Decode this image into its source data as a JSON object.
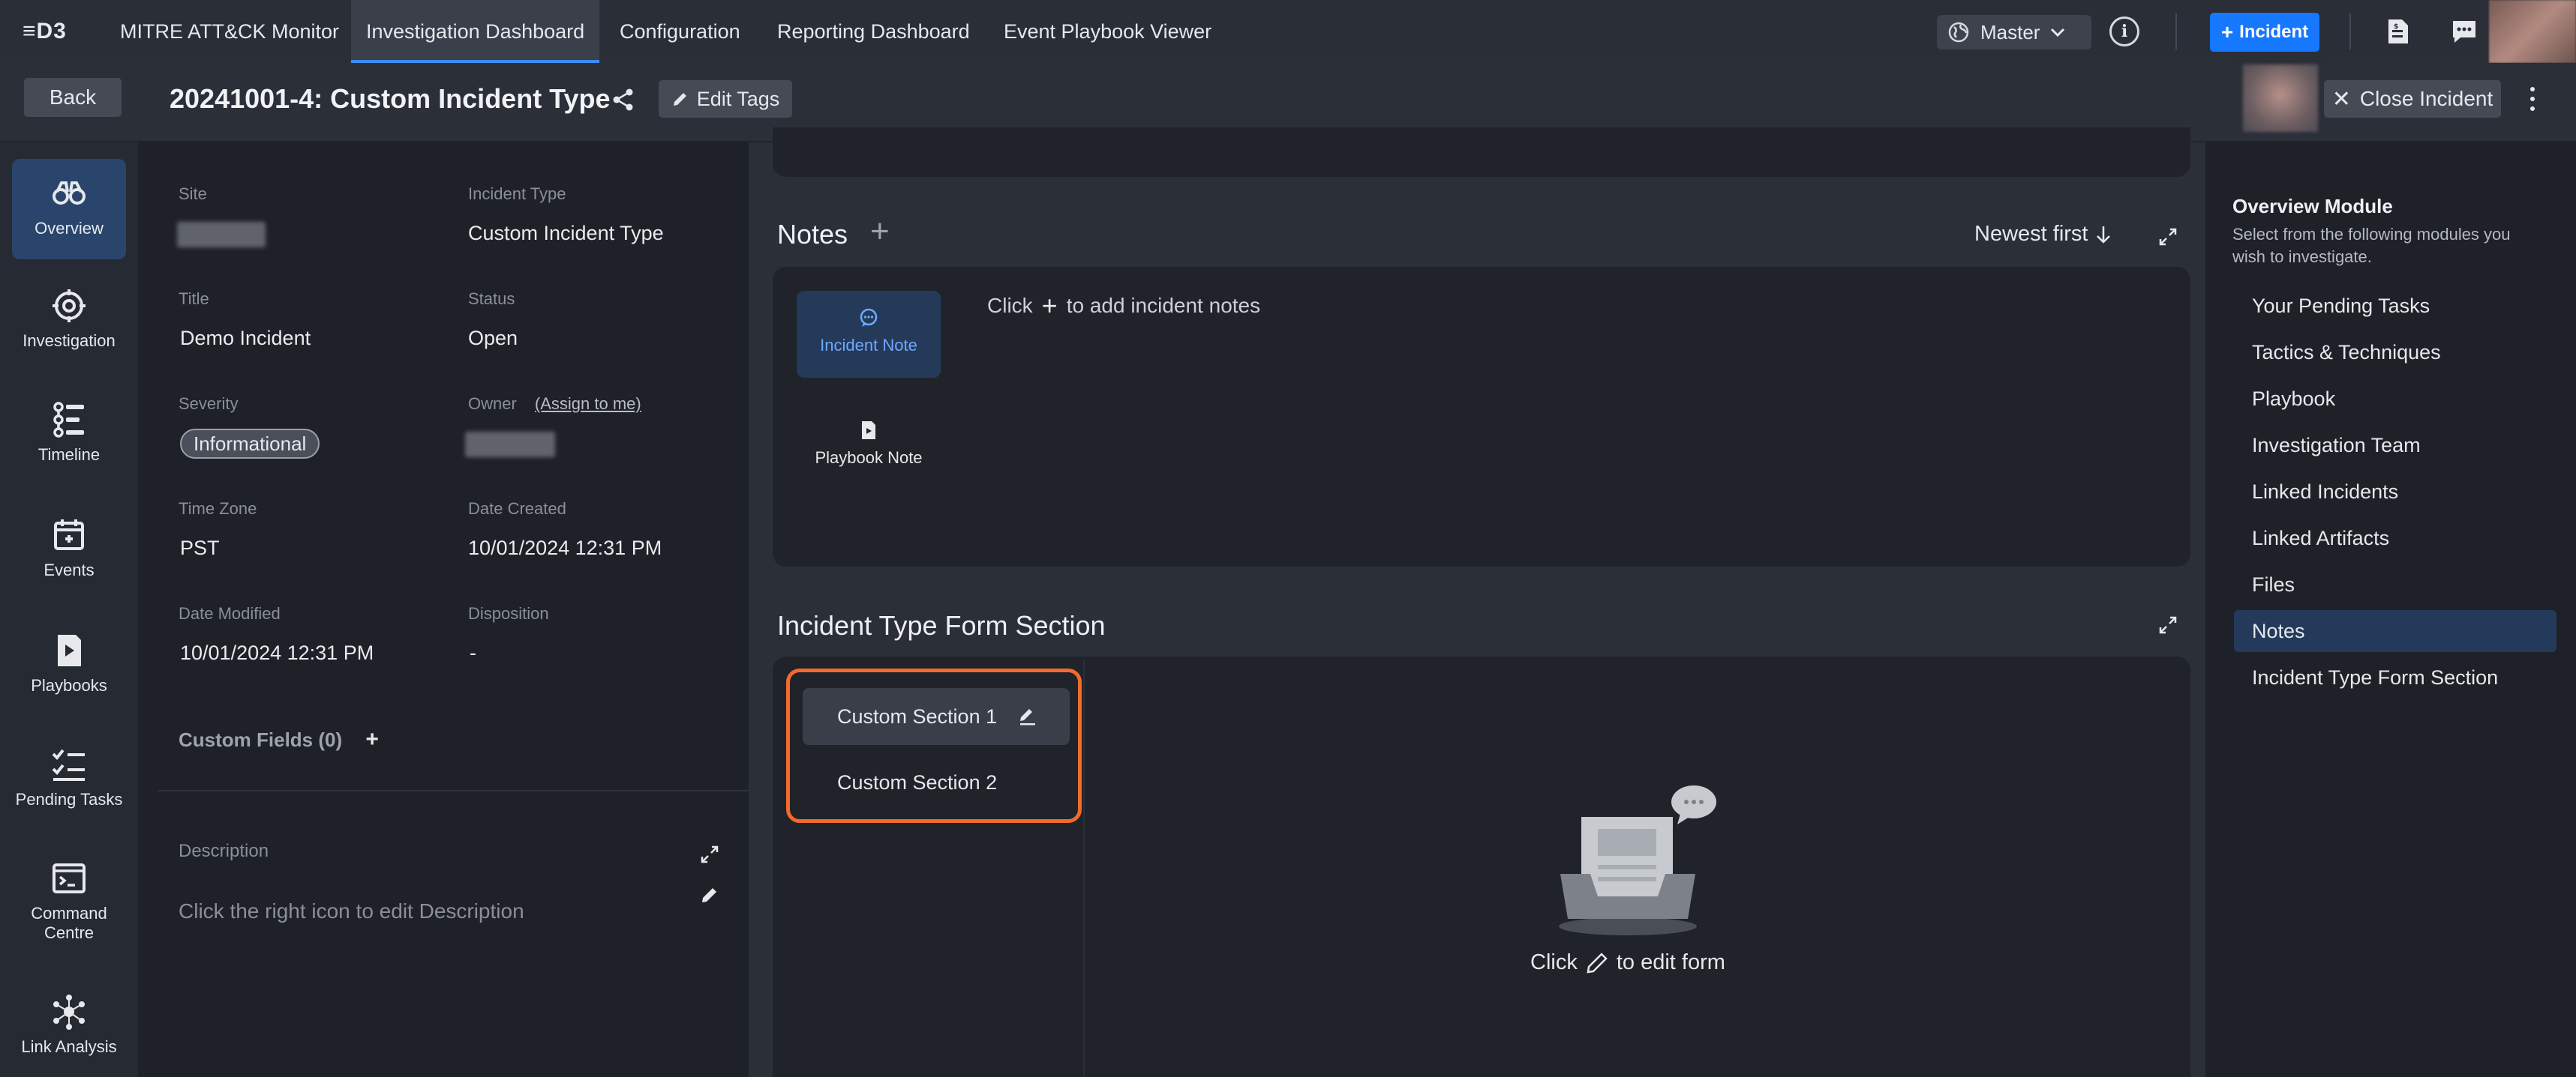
{
  "app": {
    "logo": "≡D3"
  },
  "nav": {
    "items": [
      "MITRE ATT&CK Monitor",
      "Investigation Dashboard",
      "Configuration",
      "Reporting Dashboard",
      "Event Playbook Viewer"
    ],
    "active_index": 1,
    "workspace": "Master",
    "new_incident_label": "Incident"
  },
  "header": {
    "back_label": "Back",
    "title": "20241001-4: Custom Incident Type",
    "edit_tags_label": "Edit Tags",
    "close_incident_label": "Close Incident"
  },
  "rail": {
    "items": [
      {
        "label": "Overview",
        "icon": "binoculars-icon"
      },
      {
        "label": "Investigation",
        "icon": "crosshair-icon"
      },
      {
        "label": "Timeline",
        "icon": "timeline-icon"
      },
      {
        "label": "Events",
        "icon": "calendar-icon"
      },
      {
        "label": "Playbooks",
        "icon": "playbook-icon"
      },
      {
        "label": "Pending Tasks",
        "icon": "checklist-icon"
      },
      {
        "label": "Command Centre",
        "icon": "terminal-icon"
      },
      {
        "label": "Link Analysis",
        "icon": "network-icon"
      }
    ],
    "active_index": 0
  },
  "info": {
    "site_label": "Site",
    "incident_type_label": "Incident Type",
    "incident_type": "Custom Incident Type",
    "title_label": "Title",
    "title": "Demo Incident",
    "status_label": "Status",
    "status": "Open",
    "severity_label": "Severity",
    "severity": "Informational",
    "owner_label": "Owner",
    "assign_link": "(Assign to me)",
    "timezone_label": "Time Zone",
    "timezone": "PST",
    "date_created_label": "Date Created",
    "date_created": "10/01/2024 12:31 PM",
    "date_modified_label": "Date Modified",
    "date_modified": "10/01/2024 12:31 PM",
    "disposition_label": "Disposition",
    "disposition": "-",
    "custom_fields_label": "Custom Fields (0)",
    "custom_fields_add": "+",
    "description_label": "Description",
    "description_placeholder": "Click the right icon to edit Description"
  },
  "notes": {
    "title": "Notes",
    "add_symbol": "+",
    "sort_label": "Newest first",
    "incident_note_label": "Incident Note",
    "playbook_note_label": "Playbook Note",
    "hint_pre": "Click",
    "hint_post": "to add incident notes"
  },
  "form_section": {
    "title": "Incident Type Form Section",
    "sections": [
      "Custom Section 1",
      "Custom Section 2"
    ],
    "active_index": 0,
    "hint_pre": "Click",
    "hint_post": "to edit form"
  },
  "modules": {
    "title": "Overview Module",
    "description": "Select from the following modules you wish to investigate.",
    "items": [
      "Your Pending Tasks",
      "Tactics & Techniques",
      "Playbook",
      "Investigation Team",
      "Linked Incidents",
      "Linked Artifacts",
      "Files",
      "Notes",
      "Incident Type Form Section"
    ],
    "active_index": 7
  },
  "colors": {
    "accent": "#1677ff",
    "highlight_border": "#f26a2c",
    "active_nav": "#2a456c"
  }
}
